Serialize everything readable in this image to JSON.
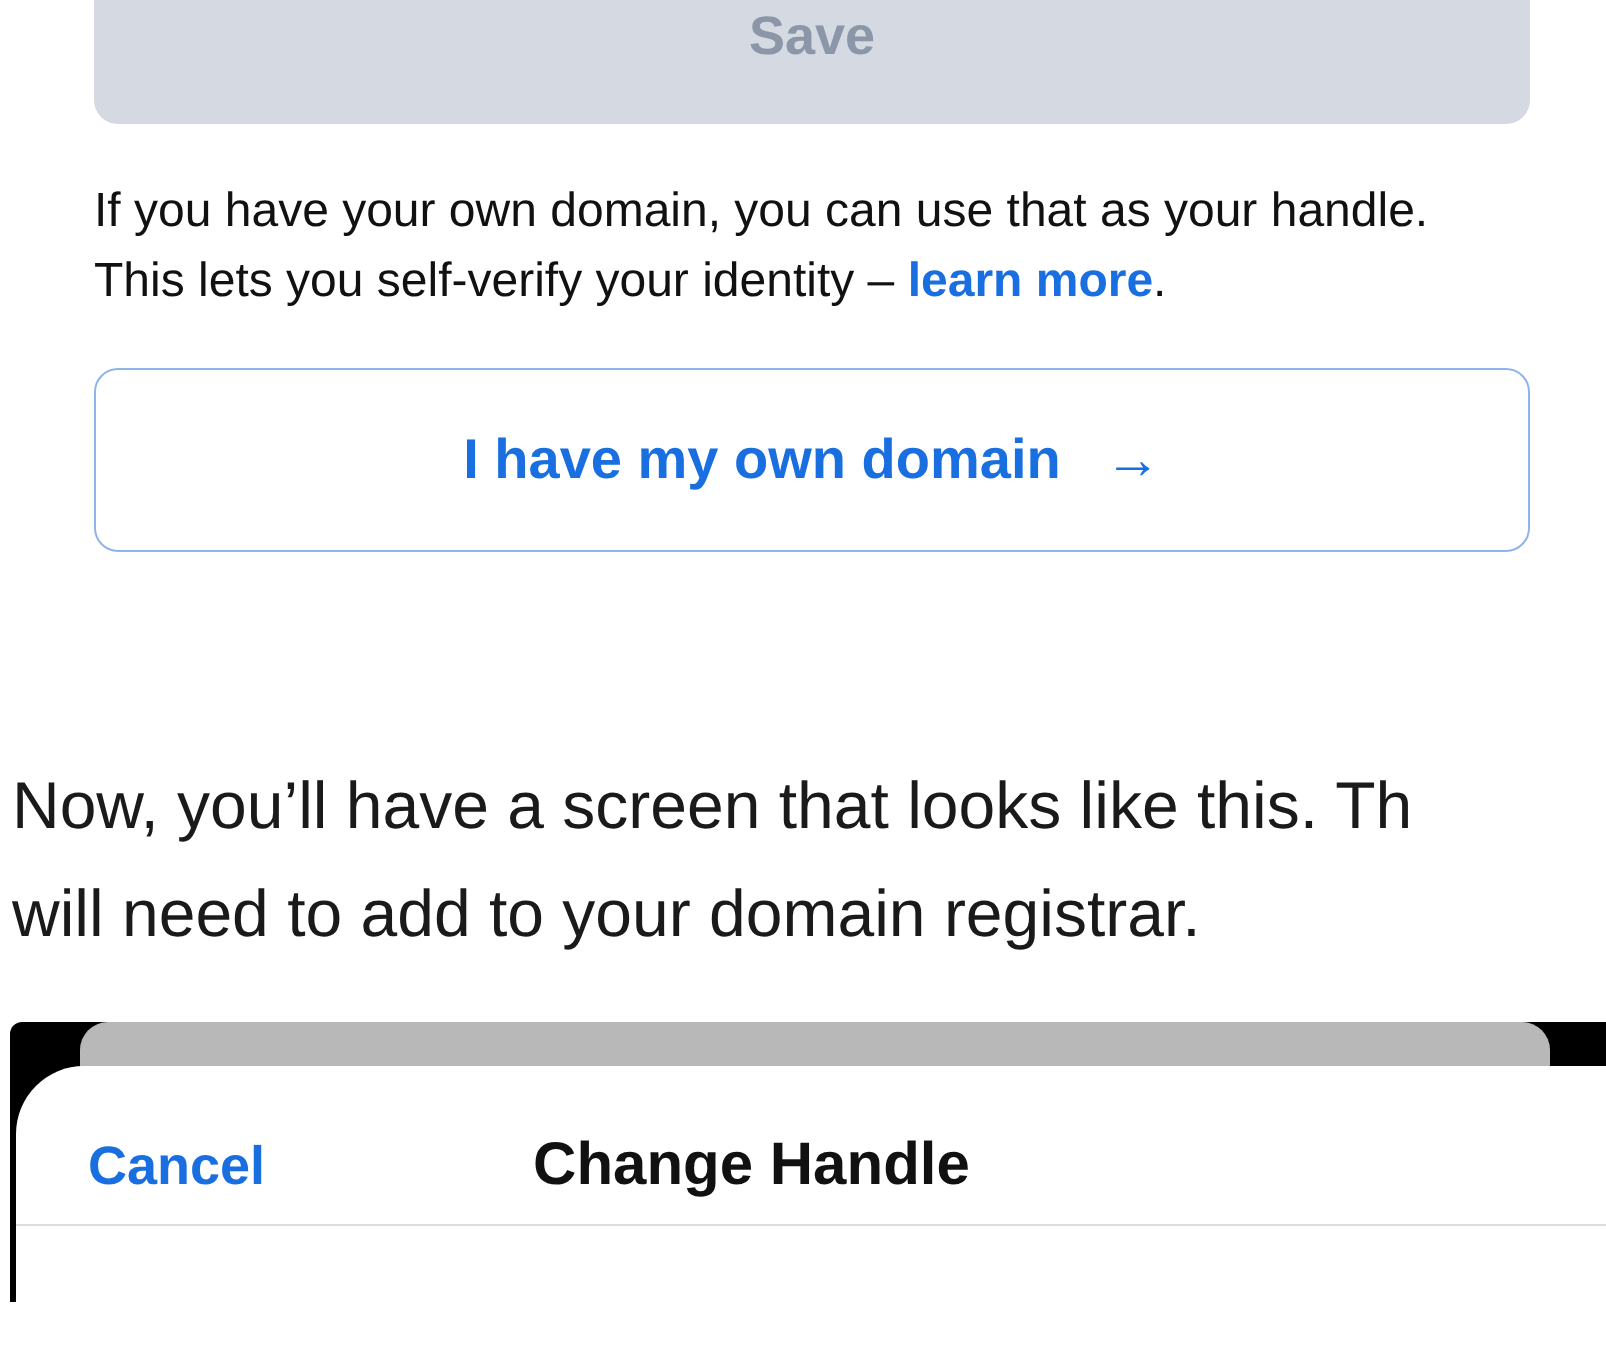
{
  "save_button": {
    "label": "Save",
    "disabled": true
  },
  "domain_note": {
    "text": "If you have your own domain, you can use that as your handle. This lets you self-verify your identity –",
    "link": "learn more",
    "end": "."
  },
  "own_domain_button": {
    "label": "I have my own domain",
    "arrow": "→"
  },
  "article_text": {
    "lines": [
      "Now, you’ll have a screen that looks like this. Th",
      "will need to add to your domain registrar."
    ]
  },
  "screenshot": {
    "cancel": "Cancel",
    "title": "Change Handle"
  }
}
